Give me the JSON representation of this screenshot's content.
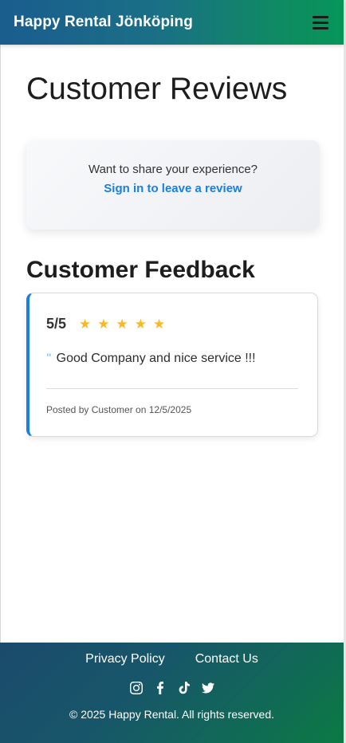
{
  "navbar": {
    "brand": "Happy Rental Jönköping",
    "menu_icon": "hamburger-menu-icon"
  },
  "main": {
    "title": "Customer Reviews",
    "cta": {
      "text": "Want to share your experience?",
      "link": "Sign in to leave a review"
    },
    "feedback_title": "Customer Feedback",
    "reviews": [
      {
        "rating": "5/5",
        "stars": 5,
        "star_icon": "star-icon",
        "quote_icon": "quote-icon",
        "quote_mark": "\"",
        "text": "Good Company and nice service !!!",
        "posted": "Posted by Customer on 12/5/2025"
      }
    ]
  },
  "footer": {
    "links": [
      "Privacy Policy",
      "Contact Us"
    ],
    "social_icons": [
      "instagram-icon",
      "facebook-icon",
      "tiktok-icon",
      "twitter-icon"
    ],
    "copyright": "© 2025 Happy Rental. All rights reserved."
  },
  "colors": {
    "accent": "#1a7fe0",
    "star": "#f7b924",
    "nav_gradient_start": "#1a5d8f",
    "nav_gradient_end": "#07955a"
  }
}
